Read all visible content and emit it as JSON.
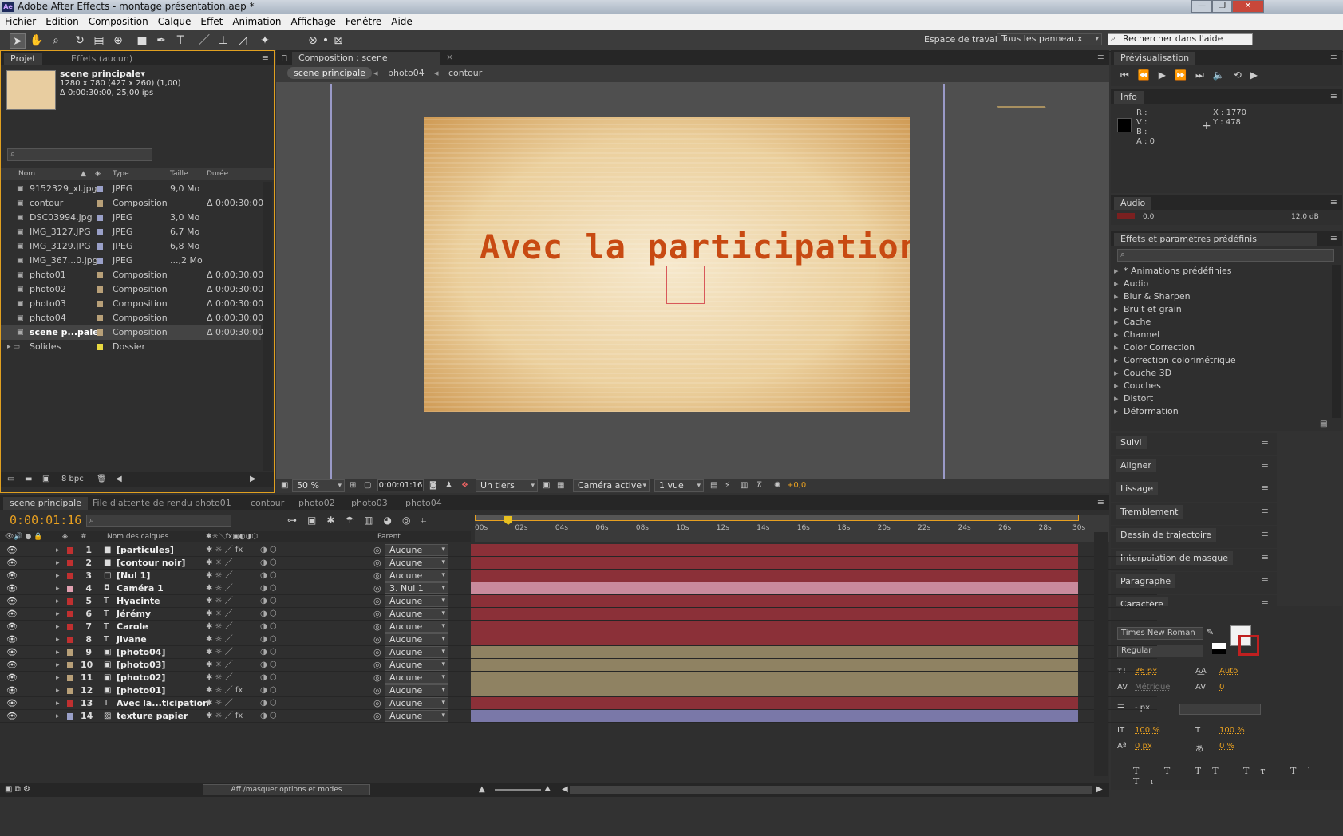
{
  "window": {
    "title": "Adobe After Effects - montage présentation.aep *"
  },
  "menu": [
    "Fichier",
    "Edition",
    "Composition",
    "Calque",
    "Effet",
    "Animation",
    "Affichage",
    "Fenêtre",
    "Aide"
  ],
  "toolbar": {
    "workspace_label": "Espace de travail :",
    "workspace_value": "Tous les panneaux",
    "search_placeholder": "Rechercher dans l'aide"
  },
  "project": {
    "tabs": [
      "Projet",
      "Effets (aucun)"
    ],
    "selected": {
      "name": "scene principale▾",
      "dims": "1280 x 780  (427 x 260) (1,00)",
      "duration": "Δ 0:00:30:00, 25,00 ips"
    },
    "headers": {
      "name": "Nom",
      "type": "Type",
      "size": "Taille",
      "duration": "Durée"
    },
    "items": [
      {
        "name": "9152329_xl.jpg",
        "type": "JPEG",
        "size": "9,0 Mo",
        "duration": "",
        "color": "#9aa0c8"
      },
      {
        "name": "contour",
        "type": "Composition",
        "size": "",
        "duration": "Δ 0:00:30:00",
        "color": "#b8a078"
      },
      {
        "name": "DSC03994.jpg",
        "type": "JPEG",
        "size": "3,0 Mo",
        "duration": "",
        "color": "#9aa0c8"
      },
      {
        "name": "IMG_3127.JPG",
        "type": "JPEG",
        "size": "6,7 Mo",
        "duration": "",
        "color": "#9aa0c8"
      },
      {
        "name": "IMG_3129.JPG",
        "type": "JPEG",
        "size": "6,8 Mo",
        "duration": "",
        "color": "#9aa0c8"
      },
      {
        "name": "IMG_367...0.jpg",
        "type": "JPEG",
        "size": "...,2 Mo",
        "duration": "",
        "color": "#9aa0c8"
      },
      {
        "name": "photo01",
        "type": "Composition",
        "size": "",
        "duration": "Δ 0:00:30:00",
        "color": "#b8a078"
      },
      {
        "name": "photo02",
        "type": "Composition",
        "size": "",
        "duration": "Δ 0:00:30:00",
        "color": "#b8a078"
      },
      {
        "name": "photo03",
        "type": "Composition",
        "size": "",
        "duration": "Δ 0:00:30:00",
        "color": "#b8a078"
      },
      {
        "name": "photo04",
        "type": "Composition",
        "size": "",
        "duration": "Δ 0:00:30:00",
        "color": "#b8a078"
      },
      {
        "name": "scene p...pale",
        "type": "Composition",
        "size": "",
        "duration": "Δ 0:00:30:00",
        "color": "#b8a078"
      },
      {
        "name": "Solides",
        "type": "Dossier",
        "size": "",
        "duration": "",
        "color": "#e8d840"
      }
    ],
    "bpc": "8 bpc"
  },
  "comp": {
    "tab": "Composition : scene principale",
    "breadcrumbs": [
      "scene principale",
      "photo04",
      "contour"
    ],
    "canvas_text": "Avec la participation",
    "zoom": "50 %",
    "timecode": "0:00:01:16",
    "resolution": "Un tiers",
    "camera": "Caméra active",
    "views": "1 vue",
    "exposure": "+0,0"
  },
  "right": {
    "preview_tab": "Prévisualisation",
    "info_tab": "Info",
    "info": {
      "r": "R :",
      "v": "V :",
      "b": "B :",
      "a": "A : 0",
      "x": "X : 1770",
      "y": "Y : 478"
    },
    "audio_tab": "Audio",
    "audio_left": "0,0",
    "audio_right": "12,0 dB",
    "effects_tab": "Effets et paramètres prédéfinis",
    "effects": [
      "* Animations prédéfinies",
      "Audio",
      "Blur & Sharpen",
      "Bruit et grain",
      "Cache",
      "Channel",
      "Color Correction",
      "Correction colorimétrique",
      "Couche 3D",
      "Couches",
      "Distort",
      "Déformation"
    ],
    "stacked": [
      "Suivi",
      "Aligner",
      "Lissage",
      "Tremblement",
      "Dessin de trajectoire",
      "Interpolation de masque",
      "Paragraphe",
      "Caractère"
    ],
    "character": {
      "font": "Times New Roman",
      "style": "Regular",
      "size": "36 px",
      "leading": "Auto",
      "kerning": "Métrique",
      "tracking": "0",
      "stroke": "- px",
      "vscale": "100 %",
      "hscale": "100 %",
      "baseline": "0 px",
      "tsume": "0 %"
    }
  },
  "timeline": {
    "tabs": [
      "scene principale",
      "File d'attente de rendu",
      "photo01",
      "contour",
      "photo02",
      "photo03",
      "photo04"
    ],
    "timecode": "0:00:01:16",
    "col_layer": "Nom des calques",
    "col_parent": "Parent",
    "ruler": [
      "00s",
      "02s",
      "04s",
      "06s",
      "08s",
      "10s",
      "12s",
      "14s",
      "16s",
      "18s",
      "20s",
      "22s",
      "24s",
      "26s",
      "28s",
      "30s"
    ],
    "layers": [
      {
        "n": "1",
        "name": "[particules]",
        "parent": "Aucune",
        "label": "#c03030",
        "bar": "#8b3038",
        "icon": "■",
        "fx": true
      },
      {
        "n": "2",
        "name": "[contour noir]",
        "parent": "Aucune",
        "label": "#c03030",
        "bar": "#8b3038",
        "icon": "■",
        "fx": false
      },
      {
        "n": "3",
        "name": "[Nul 1]",
        "parent": "Aucune",
        "label": "#c03030",
        "bar": "#8b3038",
        "icon": "□",
        "fx": false
      },
      {
        "n": "4",
        "name": "Caméra 1",
        "parent": "3. Nul 1",
        "label": "#e0a0b0",
        "bar": "#c98a9c",
        "icon": "◘",
        "fx": false
      },
      {
        "n": "5",
        "name": "Hyacinte",
        "parent": "Aucune",
        "label": "#c03030",
        "bar": "#8b3038",
        "icon": "T",
        "fx": false
      },
      {
        "n": "6",
        "name": "Jérémy",
        "parent": "Aucune",
        "label": "#c03030",
        "bar": "#8b3038",
        "icon": "T",
        "fx": false
      },
      {
        "n": "7",
        "name": "Carole",
        "parent": "Aucune",
        "label": "#c03030",
        "bar": "#8b3038",
        "icon": "T",
        "fx": false
      },
      {
        "n": "8",
        "name": "Jivane",
        "parent": "Aucune",
        "label": "#c03030",
        "bar": "#8b3038",
        "icon": "T",
        "fx": false
      },
      {
        "n": "9",
        "name": "[photo04]",
        "parent": "Aucune",
        "label": "#b8a078",
        "bar": "#8f8262",
        "icon": "▣",
        "fx": false
      },
      {
        "n": "10",
        "name": "[photo03]",
        "parent": "Aucune",
        "label": "#b8a078",
        "bar": "#8f8262",
        "icon": "▣",
        "fx": false
      },
      {
        "n": "11",
        "name": "[photo02]",
        "parent": "Aucune",
        "label": "#b8a078",
        "bar": "#8f8262",
        "icon": "▣",
        "fx": false
      },
      {
        "n": "12",
        "name": "[photo01]",
        "parent": "Aucune",
        "label": "#b8a078",
        "bar": "#8f8262",
        "icon": "▣",
        "fx": true
      },
      {
        "n": "13",
        "name": "Avec la...ticipation",
        "parent": "Aucune",
        "label": "#c03030",
        "bar": "#8b3038",
        "icon": "T",
        "fx": false
      },
      {
        "n": "14",
        "name": "texture papier",
        "parent": "Aucune",
        "label": "#9aa0c8",
        "bar": "#7a78a8",
        "icon": "▨",
        "fx": true
      }
    ],
    "toggle_label": "Aff./masquer options et modes",
    "playhead_time": 1.64,
    "duration_s": 30
  },
  "colors": {
    "accent": "#e8a020",
    "playhead": "#e02020"
  }
}
